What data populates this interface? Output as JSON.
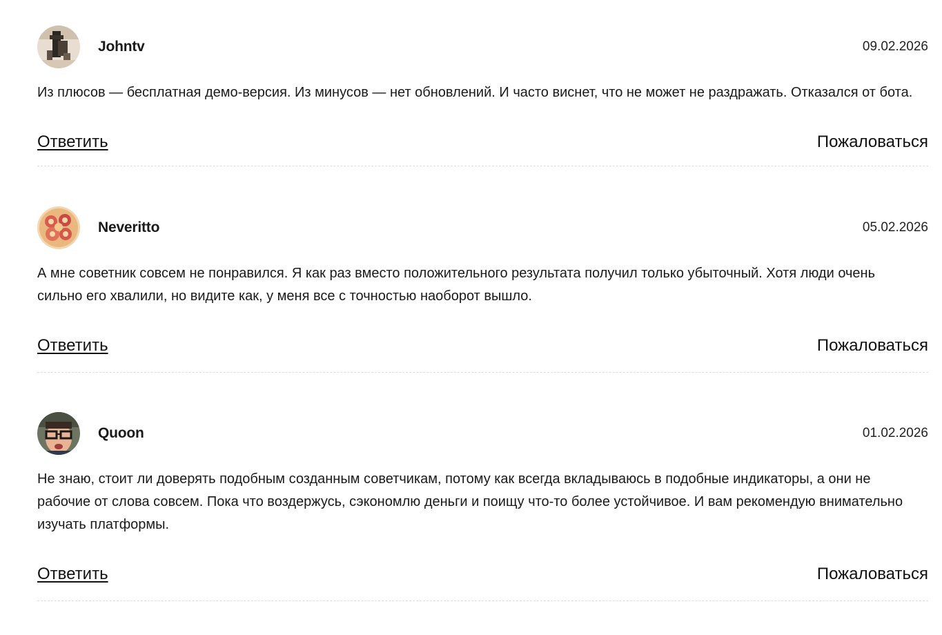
{
  "comments": [
    {
      "author": "Johntv",
      "date": "09.02.2026",
      "text": "Из плюсов — бесплатная демо-версия. Из минусов — нет обновлений. И часто виснет, что не может не раздражать. Отказался от бота.",
      "reply_label": "Ответить",
      "report_label": "Пожаловаться"
    },
    {
      "author": "Neveritto",
      "date": "05.02.2026",
      "text": "А мне советник совсем не понравился. Я как раз вместо положительного результата получил только убыточный. Хотя люди очень сильно его хвалили, но видите как, у меня все с точностью наоборот вышло.",
      "reply_label": "Ответить",
      "report_label": "Пожаловаться"
    },
    {
      "author": "Quoon",
      "date": "01.02.2026",
      "text": "Не знаю, стоит ли доверять подобным созданным советчикам, потому как всегда вкладываюсь в подобные индикаторы, а они не рабочие от слова совсем. Пока что воздержусь, сэкономлю деньги и поищу что-то более устойчивое. И вам рекомендую внимательно изучать платформы.",
      "reply_label": "Ответить",
      "report_label": "Пожаловаться"
    }
  ]
}
